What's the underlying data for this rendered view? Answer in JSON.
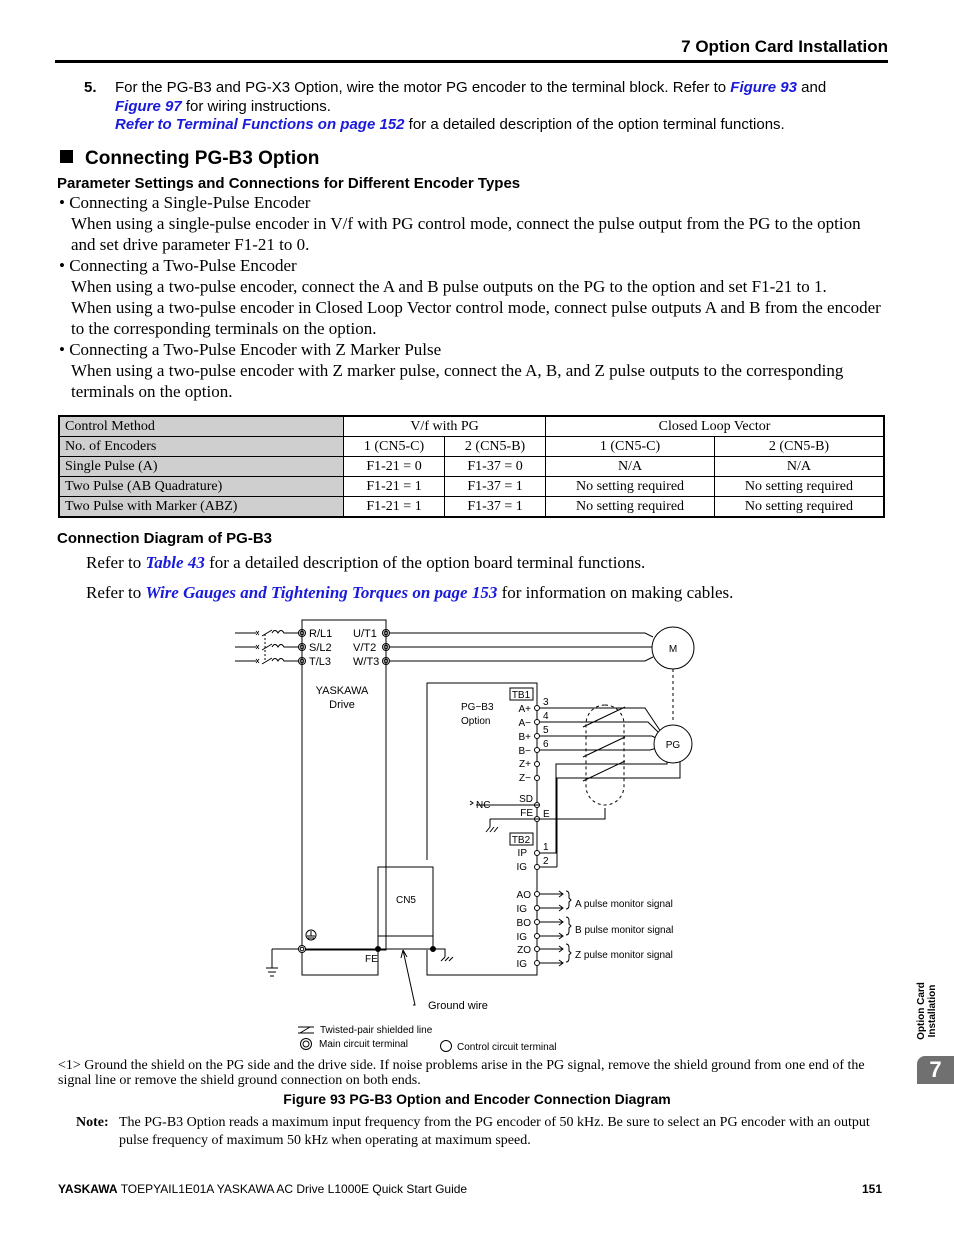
{
  "header": {
    "section_title": "7  Option Card Installation"
  },
  "step5": {
    "number": "5.",
    "text_1": "For the PG-B3 and PG-X3 Option, wire the motor PG encoder to the terminal block. Refer to ",
    "link_fig93": "Figure 93",
    "text_2": " and ",
    "link_fig97": "Figure 97",
    "text_3": " for wiring instructions.",
    "link_terminal": "Refer to Terminal Functions on page 152",
    "text_4": " for a detailed description of the option terminal functions."
  },
  "section": {
    "title": "Connecting PG-B3 Option",
    "subtitle": "Parameter Settings and Connections for Different Encoder Types",
    "bullets": [
      {
        "label": "• Connecting a Single-Pulse Encoder",
        "paras": [
          "When using a single-pulse encoder in V/f with PG control mode, connect the pulse output from the PG to the option and set drive parameter F1-21 to 0."
        ]
      },
      {
        "label": "• Connecting a Two-Pulse Encoder",
        "paras": [
          "When using a two-pulse encoder, connect the A and B pulse outputs on the PG to the option and set F1-21 to 1.",
          "When using a two-pulse encoder in Closed Loop Vector control mode, connect pulse outputs A and B from the encoder to the corresponding terminals on the option."
        ]
      },
      {
        "label": "• Connecting a Two-Pulse Encoder with Z Marker Pulse",
        "paras": [
          "When using a two-pulse encoder with Z marker pulse, connect the A, B, and Z pulse outputs to the corresponding terminals on the option."
        ]
      }
    ]
  },
  "table": {
    "header_row": {
      "label": "Control Method",
      "groups": [
        "V/f with PG",
        "Closed Loop Vector"
      ]
    },
    "rows": [
      {
        "label": "No. of Encoders",
        "cells": [
          "1 (CN5-C)",
          "2 (CN5-B)",
          "1 (CN5-C)",
          "2 (CN5-B)"
        ]
      },
      {
        "label": "Single Pulse (A)",
        "cells": [
          "F1-21 = 0",
          "F1-37 = 0",
          "N/A",
          "N/A"
        ]
      },
      {
        "label": "Two Pulse (AB Quadrature)",
        "cells": [
          "F1-21 = 1",
          "F1-37 = 1",
          "No setting required",
          "No setting required"
        ]
      },
      {
        "label": "Two Pulse with Marker (ABZ)",
        "cells": [
          "F1-21 = 1",
          "F1-37 = 1",
          "No setting required",
          "No setting required"
        ]
      }
    ]
  },
  "connection": {
    "title": "Connection Diagram of PG-B3",
    "ref1_pre": "Refer to ",
    "ref1_link": "Table 43",
    "ref1_post": " for a detailed description of the option board terminal functions.",
    "ref2_pre": "Refer to ",
    "ref2_link": "Wire Gauges and Tightening Torques on page 153",
    "ref2_post": " for information on making cables."
  },
  "diagram": {
    "input_terminals": [
      "R/L1",
      "S/L2",
      "T/L3"
    ],
    "output_terminals": [
      "U/T1",
      "V/T2",
      "W/T3"
    ],
    "drive_label_1": "YASKAWA",
    "drive_label_2": "Drive",
    "motor_label": "M",
    "encoder_label": "PG",
    "option_label_1": "PG−B3",
    "option_label_2": "Option",
    "tb1": "TB1",
    "tb2": "TB2",
    "tb1_terminals": [
      "A+",
      "A−",
      "B+",
      "B−",
      "Z+",
      "Z−",
      "SD",
      "FE"
    ],
    "tb1_numbers": [
      "3",
      "4",
      "5",
      "6"
    ],
    "fe_number": "E",
    "nc_label": "NC",
    "tb2_terminals": [
      "IP",
      "IG"
    ],
    "tb2_numbers": [
      "1",
      "2"
    ],
    "monitor_terminals": [
      "AO",
      "IG",
      "BO",
      "IG",
      "ZO",
      "IG"
    ],
    "monitor_signals": [
      "A pulse monitor signal",
      "B pulse monitor signal",
      "Z pulse monitor signal"
    ],
    "cn5_label": "CN5",
    "fe_label": "FE",
    "ground_wire_label": "Ground wire",
    "legend": {
      "twisted_pair": "Twisted-pair shielded line",
      "main_terminal": "Main circuit terminal",
      "control_terminal": "Control circuit terminal"
    }
  },
  "footnote": {
    "marker": "<1>",
    "text": "Ground the shield on the PG side and the drive side. If noise problems arise in the PG signal, remove the shield ground from one end of the signal line or remove the shield ground connection on both ends."
  },
  "figure_caption": "Figure 93  PG-B3 Option and Encoder Connection Diagram",
  "note": {
    "label": "Note:",
    "text": "The PG-B3 Option reads a maximum input frequency from the PG encoder of 50 kHz. Be sure to select an PG encoder with an output pulse frequency of maximum 50 kHz when operating at maximum speed."
  },
  "footer": {
    "brand": "YASKAWA",
    "doc": " TOEPYAIL1E01A YASKAWA AC Drive L1000E Quick Start Guide",
    "page": "151"
  },
  "side_tab": {
    "label": "Option Card Installation",
    "chapter": "7"
  }
}
